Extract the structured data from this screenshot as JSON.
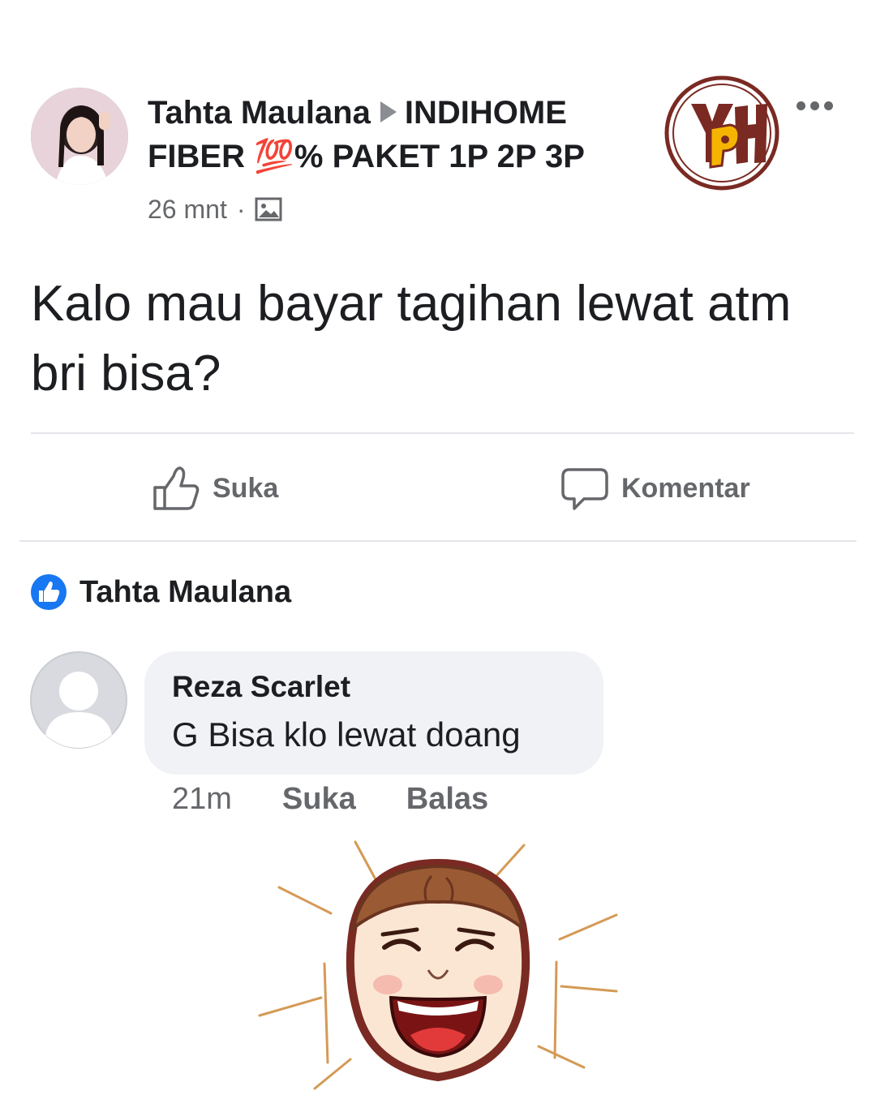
{
  "post": {
    "author": "Tahta Maulana",
    "group": "INDIHOME FIBER 💯% PAKET 1P 2P 3P",
    "time": "26 mnt",
    "separator": "·",
    "text": "Kalo mau bayar tagihan lewat atm bri bisa?"
  },
  "actions": {
    "like_label": "Suka",
    "comment_label": "Komentar"
  },
  "reactions": {
    "name": "Tahta Maulana"
  },
  "comment": {
    "author": "Reza Scarlet",
    "text": "G Bisa klo lewat doang",
    "time": "21m",
    "like_label": "Suka",
    "reply_label": "Balas"
  },
  "brand_badge": {
    "letters": "YPH"
  },
  "icons": {
    "more": "more-horizontal-icon",
    "photo": "photo-icon",
    "like": "thumbs-up-icon",
    "comment": "comment-icon",
    "reaction": "like-reaction-icon"
  },
  "colors": {
    "text": "#1c1e21",
    "secondary": "#65676b",
    "bubble": "#f0f2f5",
    "like_blue": "#1877f2",
    "badge_brown": "#7a2a22",
    "badge_yellow": "#f5b400"
  }
}
